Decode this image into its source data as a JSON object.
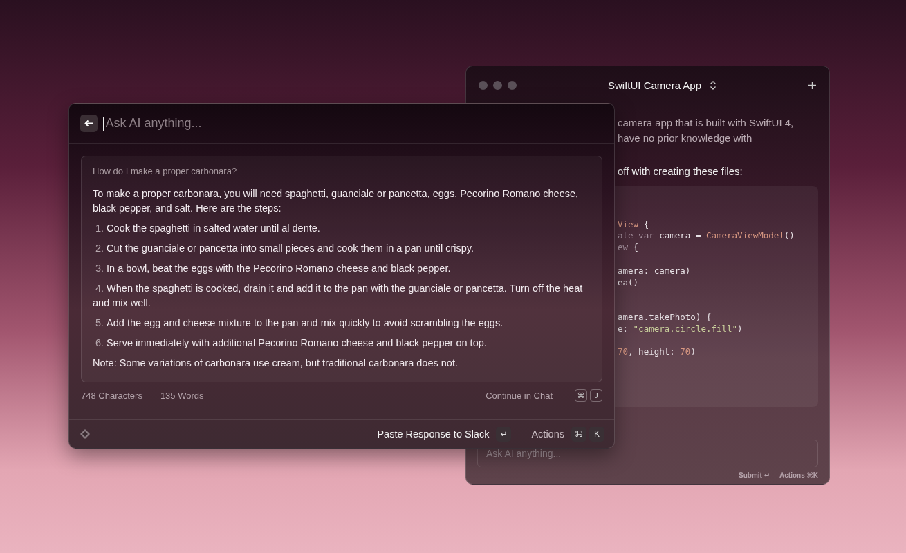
{
  "back_window": {
    "title": "SwiftUI Camera App",
    "intro_lines": [
      "camera app that is built with SwiftUI 4,",
      "have no prior knowledge with"
    ],
    "lead": "off with creating these files:",
    "code_lines": [
      {
        "kind": "first",
        "tokens": [
          {
            "kind": "type",
            "text": "View"
          },
          {
            "kind": "plain",
            "text": " {"
          }
        ]
      },
      {
        "kind": "line",
        "tokens": [
          {
            "kind": "keyword",
            "text": "ate var"
          },
          {
            "kind": "plain",
            "text": " camera = "
          },
          {
            "kind": "type",
            "text": "CameraViewModel"
          },
          {
            "kind": "plain",
            "text": "()"
          }
        ]
      },
      {
        "kind": "line",
        "tokens": [
          {
            "kind": "keyword",
            "text": "ew"
          },
          {
            "kind": "plain",
            "text": " {"
          }
        ]
      },
      {
        "kind": "after_gap",
        "tokens": [
          {
            "kind": "plain",
            "text": "amera: camera)"
          }
        ]
      },
      {
        "kind": "line",
        "tokens": [
          {
            "kind": "plain",
            "text": "ea()"
          }
        ]
      },
      {
        "kind": "after_double_gap",
        "tokens": [
          {
            "kind": "plain",
            "text": "amera.takePhoto) {"
          }
        ]
      },
      {
        "kind": "line",
        "tokens": [
          {
            "kind": "plain",
            "text": "e: "
          },
          {
            "kind": "string",
            "text": "\"camera.circle.fill\""
          },
          {
            "kind": "plain",
            "text": ")"
          }
        ]
      },
      {
        "kind": "after_gap",
        "tokens": [
          {
            "kind": "number",
            "text": "70"
          },
          {
            "kind": "plain",
            "text": ", height: "
          },
          {
            "kind": "number",
            "text": "70"
          },
          {
            "kind": "plain",
            "text": ")"
          }
        ]
      }
    ],
    "input": {
      "placeholder": "Ask AI anything..."
    },
    "hints": [
      "Submit ↵",
      "Actions ⌘K"
    ]
  },
  "front_window": {
    "search": {
      "placeholder": "Ask AI anything..."
    },
    "question": "How do I make a proper carbonara?",
    "answer_intro": "To make a proper carbonara, you will need spaghetti, guanciale or pancetta, eggs, Pecorino Romano cheese, black pepper, and salt. Here are the steps:",
    "steps": [
      {
        "number": "1.",
        "text": "Cook the spaghetti in salted water until al dente."
      },
      {
        "number": "2.",
        "text": "Cut the guanciale or pancetta into small pieces and cook them in a pan until crispy."
      },
      {
        "number": "3.",
        "text": "In a bowl, beat the eggs with the Pecorino Romano cheese and black pepper."
      },
      {
        "number": "4.",
        "text": "When the spaghetti is cooked, drain it and add it to the pan with the guanciale or pancetta. Turn off the heat and mix well."
      },
      {
        "number": "5.",
        "text": "Add the egg and cheese mixture to the pan and mix quickly to avoid scrambling the eggs."
      },
      {
        "number": "6.",
        "text": "Serve immediately with additional Pecorino Romano cheese and black pepper on top."
      }
    ],
    "note": "Note: Some variations of carbonara use cream, but traditional carbonara does not.",
    "stats": [
      "748 Characters",
      "135 Words"
    ],
    "continue": {
      "label": "Continue in Chat",
      "keys": [
        "⌘",
        "J"
      ]
    },
    "primary_action": {
      "label": "Paste Response to Slack",
      "keys": [
        "↵"
      ]
    },
    "actions": {
      "label": "Actions",
      "keys": [
        "⌘",
        "K"
      ]
    }
  }
}
